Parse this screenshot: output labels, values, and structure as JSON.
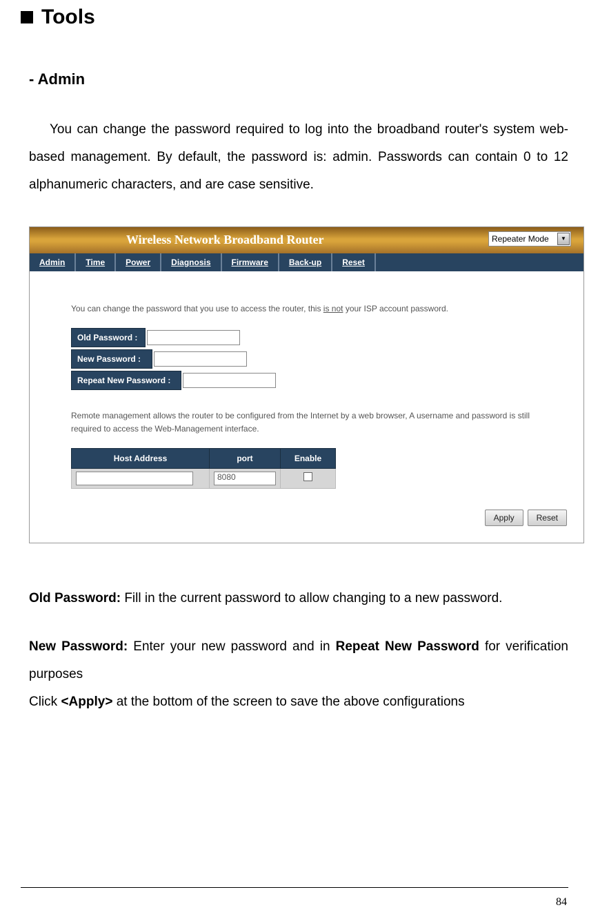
{
  "section": {
    "title": "Tools"
  },
  "subsection": {
    "title": "- Admin"
  },
  "intro": "You can change the password required to log into the broadband router's system web-based management. By default, the password is: admin. Passwords can contain 0 to 12 alphanumeric characters, and are case sensitive.",
  "router": {
    "title": "Wireless Network Broadband Router",
    "mode": "Repeater Mode",
    "tabs": [
      "Admin",
      "Time",
      "Power",
      "Diagnosis",
      "Firmware",
      "Back-up",
      "Reset"
    ],
    "help1a": "You can change the password that you use to access the router, this ",
    "help1b": "is not",
    "help1c": " your ISP account password.",
    "labels": {
      "old": "Old Password :",
      "new": "New Password :",
      "repeat": "Repeat New Password :"
    },
    "help2": "Remote management allows the router to be configured from the Internet by a web browser, A username and password is still required to access the Web-Management interface.",
    "table": {
      "headers": {
        "host": "Host Address",
        "port": "port",
        "enable": "Enable"
      },
      "port_value": "8080"
    },
    "buttons": {
      "apply": "Apply",
      "reset": "Reset"
    }
  },
  "desc_old_label": "Old Password: ",
  "desc_old_text": "Fill in the current password to allow changing to a new password.",
  "desc_new_label": "New Password: ",
  "desc_new_mid": "Enter your new password and in ",
  "desc_new_bold2": "Repeat New Password ",
  "desc_new_end": "for verification purposes",
  "desc_click_a": "Click ",
  "desc_click_b": "<Apply>",
  "desc_click_c": " at the bottom of the screen to save the above configurations",
  "page_number": "84"
}
